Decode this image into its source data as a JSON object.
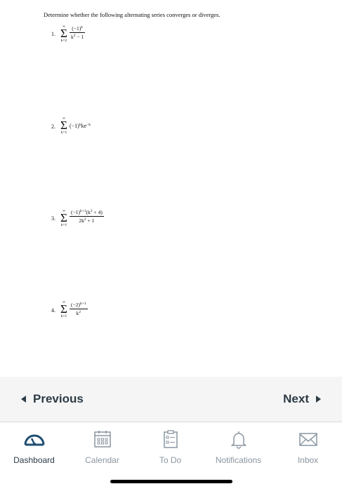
{
  "document": {
    "instructions": "Determine whether the following alternating series converges or diverges.",
    "problems": [
      {
        "number": "1.",
        "sum_upper": "∞",
        "sum_lower": "k=2",
        "numerator": "(−1)",
        "numerator_sup": "k",
        "denominator": "k",
        "denominator_sup": "2",
        "denominator_tail": " − 1"
      },
      {
        "number": "2.",
        "sum_upper": "∞",
        "sum_lower": "k=1",
        "term_a": "(−1)",
        "term_a_sup": "k",
        "term_b": "ke",
        "term_b_sup": "−k"
      },
      {
        "number": "3.",
        "sum_upper": "∞",
        "sum_lower": "k=1",
        "numerator": "(−1)",
        "numerator_sup": "k+1",
        "numerator_tail_a": "(k",
        "numerator_tail_sup": "2",
        "numerator_tail_b": " + 4)",
        "denominator": "2k",
        "denominator_sup": "2",
        "denominator_tail": " + 1"
      },
      {
        "number": "4.",
        "sum_upper": "∞",
        "sum_lower": "k=1",
        "numerator": "(−2)",
        "numerator_sup": "k+1",
        "denominator": "k",
        "denominator_sup": "2"
      }
    ]
  },
  "navigation": {
    "previous_label": "Previous",
    "next_label": "Next"
  },
  "tabbar": {
    "tabs": [
      {
        "label": "Dashboard",
        "icon": "dashboard-icon",
        "active": true
      },
      {
        "label": "Calendar",
        "icon": "calendar-icon",
        "active": false
      },
      {
        "label": "To Do",
        "icon": "todo-icon",
        "active": false
      },
      {
        "label": "Notifications",
        "icon": "bell-icon",
        "active": false
      },
      {
        "label": "Inbox",
        "icon": "inbox-icon",
        "active": false
      }
    ]
  },
  "colors": {
    "active_tab": "#2d3b45",
    "inactive_tab": "#8b96a0",
    "nav_bar_background": "#f5f5f5"
  }
}
